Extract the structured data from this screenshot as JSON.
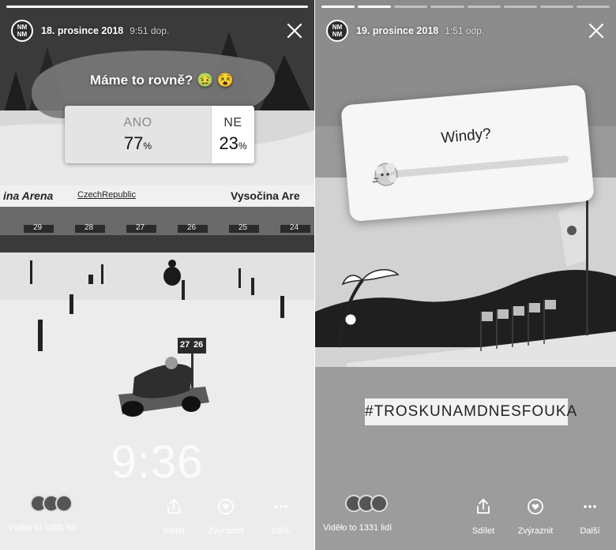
{
  "stories": [
    {
      "avatar_text": "NM NM",
      "date": "18. prosince 2018",
      "time": "9:51 dop.",
      "poll": {
        "question": "Máme to rovně? 🤢 😵",
        "options": [
          {
            "label": "ANO",
            "percent": "77",
            "unit": "%"
          },
          {
            "label": "NE",
            "percent": "23",
            "unit": "%"
          }
        ]
      },
      "banner_texts": [
        "ina Arena",
        "CzechRepublic",
        "Vysočina Are"
      ],
      "lane_numbers": [
        "29",
        "28",
        "27",
        "26",
        "25",
        "24"
      ],
      "target_numbers": [
        "27",
        "26"
      ],
      "timer": "9:36",
      "viewers": "Viděło to 1085 lidí",
      "actions": {
        "share": "Sdílet",
        "highlight": "Zvýraznit",
        "more": "Další"
      },
      "progress": {
        "segments": 1,
        "done": 1
      }
    },
    {
      "avatar_text": "NM NM",
      "date": "19. prosince 2018",
      "time": "1:51 odp.",
      "slider": {
        "question": "Windy?",
        "emoji": "wind-face",
        "value": 0.0
      },
      "hashtag": "#TROSKUNAMDNESFOUKA",
      "viewers": "Viděło to 1331 lidí",
      "actions": {
        "share": "Sdílet",
        "highlight": "Zvýraznit",
        "more": "Další"
      },
      "progress": {
        "segments": 8,
        "done": 2
      }
    }
  ],
  "colors": {
    "bg_dark": "#1a1a1a",
    "snow": "#e8e8e8",
    "sky": "#d4d4d4",
    "card": "#f6f6f6"
  }
}
